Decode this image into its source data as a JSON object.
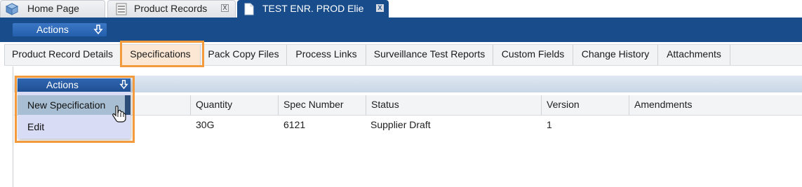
{
  "window_tabs": [
    {
      "label": "Home Page",
      "icon": "home-box-icon"
    },
    {
      "label": "Product Records",
      "icon": "records-list-icon",
      "close": "X"
    },
    {
      "label": "TEST ENR. PROD Elie",
      "icon": "document-icon",
      "close": "X",
      "active": true
    }
  ],
  "header": {
    "actions_label": "Actions"
  },
  "sub_tabs": [
    "Product Record Details",
    "Specifications",
    "Pack Copy Files",
    "Process Links",
    "Surveillance Test Reports",
    "Custom Fields",
    "Change History",
    "Attachments"
  ],
  "selected_sub_tab": "Specifications",
  "grid": {
    "columns": [
      "Quantity",
      "Spec Number",
      "Status",
      "Version",
      "Amendments"
    ],
    "rows": [
      {
        "quantity": "30G",
        "spec_number": "6121",
        "status": "Supplier Draft",
        "version": "1",
        "amendments": ""
      }
    ]
  },
  "actions_menu": {
    "label": "Actions",
    "items": [
      "New Specification",
      "Edit"
    ],
    "hovered": "New Specification"
  },
  "colors": {
    "header_blue": "#184c8a",
    "highlight_orange": "#f29a3c",
    "menu_bg": "#d8dcf4"
  }
}
